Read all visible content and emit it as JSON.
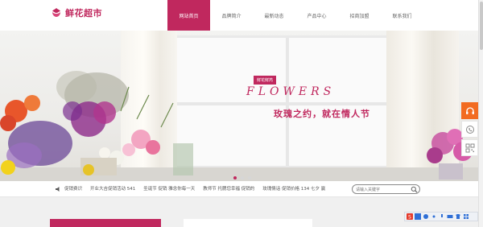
{
  "header": {
    "logo_text": "鲜花超市",
    "nav": [
      {
        "label": "网站首页",
        "active": true
      },
      {
        "label": "品牌简介",
        "active": false
      },
      {
        "label": "最新动态",
        "active": false
      },
      {
        "label": "产品中心",
        "active": false
      },
      {
        "label": "招商加盟",
        "active": false
      },
      {
        "label": "联系我们",
        "active": false
      }
    ]
  },
  "banner": {
    "tag": "鲜花鲜芮",
    "title_en": "FLOWERS",
    "title_cn": "玫瑰之约，就在情人节",
    "slides": 3,
    "active_slide": 1
  },
  "news": {
    "items": [
      "促销费识",
      "开业大吉促销活动 541",
      "圣诞节 促销 雅念你每一天",
      "教师节 托腮您幸福 促销的",
      "玫瑰情话 促销价格 134 七夕 赢"
    ]
  },
  "search": {
    "placeholder": "请输入关键字"
  },
  "colors": {
    "brand": "#c0285e",
    "tool_accent": "#f26b21"
  },
  "icons": {
    "tools": [
      "headset-icon",
      "phone-icon",
      "qrcode-icon"
    ]
  }
}
